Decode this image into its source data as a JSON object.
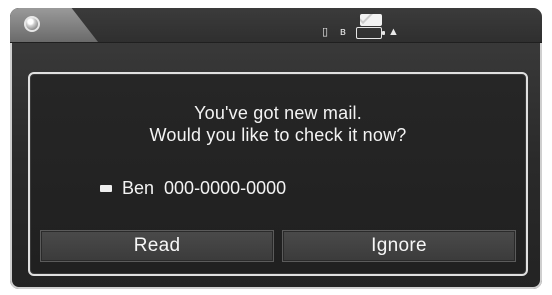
{
  "status_bar": {
    "icons": [
      "home-icon",
      "mail-icon",
      "phone-icon",
      "bluetooth-icon",
      "battery-icon",
      "signal-icon"
    ],
    "glyphs": {
      "phone": "▯",
      "bluetooth": "ʙ",
      "signal": "▲"
    }
  },
  "dialog": {
    "message_lines": [
      "You've got new mail.",
      "Would you like to check it now?"
    ],
    "sender": {
      "name": "Ben",
      "number": "000-0000-0000"
    },
    "buttons": {
      "read": "Read",
      "ignore": "Ignore"
    }
  }
}
